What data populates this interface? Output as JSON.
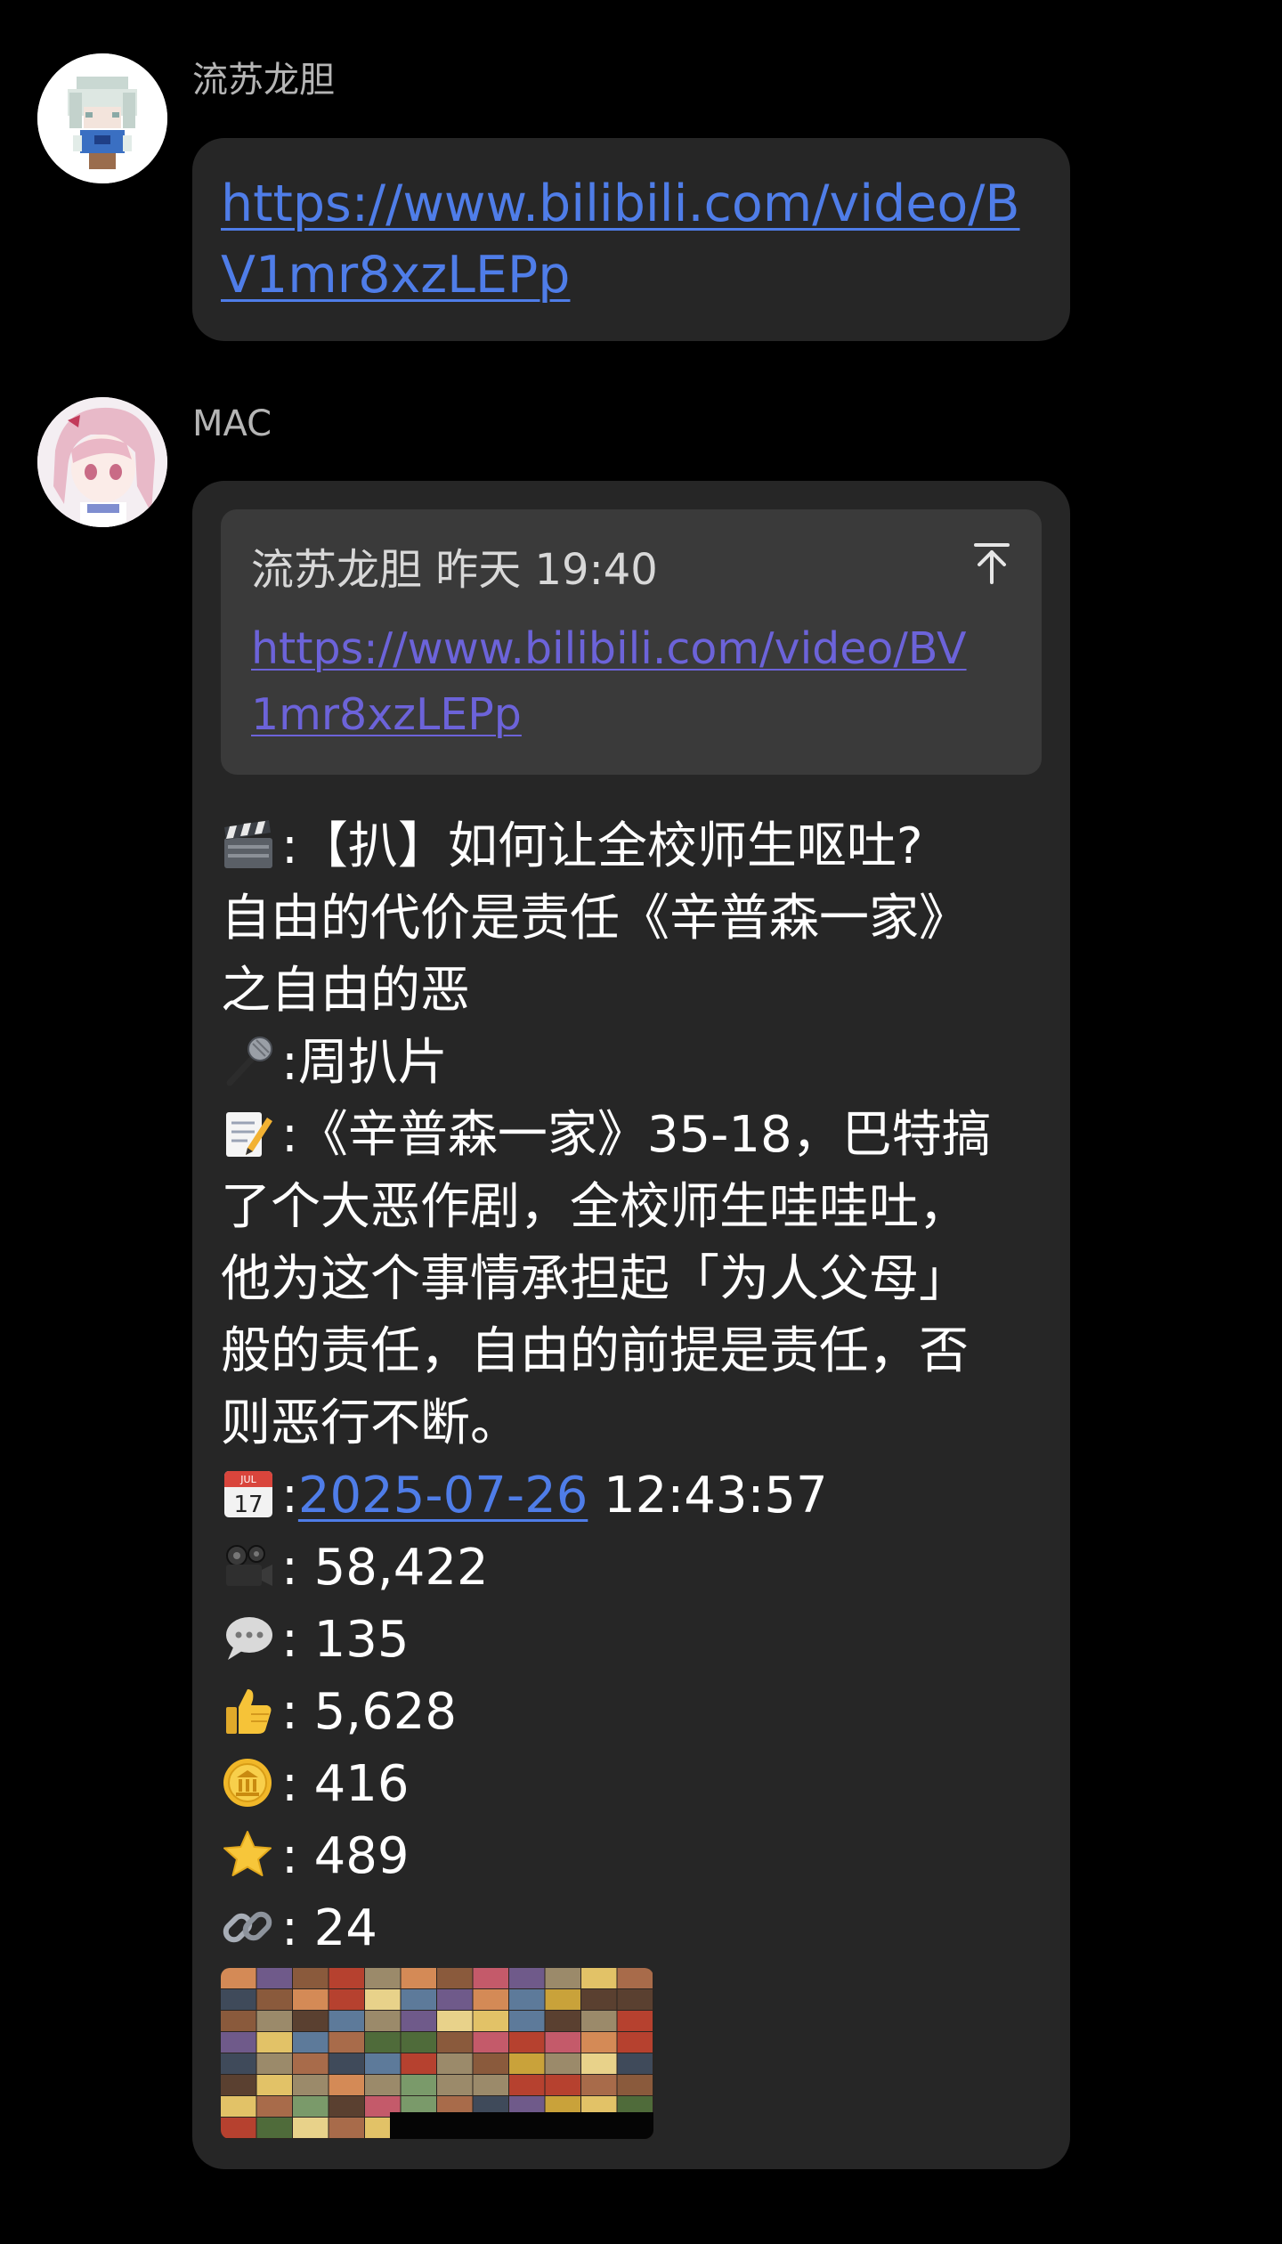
{
  "messages": [
    {
      "sender": "流苏龙胆",
      "link": "https://www.bilibili.com/video/BV1mr8xzLEPp"
    },
    {
      "sender": "MAC",
      "quote": {
        "author": "流苏龙胆",
        "time": "昨天 19:40",
        "header": "流苏龙胆 昨天 19:40",
        "link": "https://www.bilibili.com/video/BV1mr8xzLEPp"
      },
      "lines": {
        "title1": ":【扒】如何让全校师生呕吐?",
        "title2": "自由的代价是责任《辛普森一家》",
        "title3": "之自由的恶",
        "uploader": ":周扒片",
        "desc1": ":《辛普森一家》35-18，巴特搞",
        "desc2": "了个大恶作剧，全校师生哇哇吐，",
        "desc3": "他为这个事情承担起「为人父母」",
        "desc4": "般的责任，自由的前提是责任，否",
        "desc5": "则恶行不断。",
        "date_prefix": ":",
        "date": "2025-07-26",
        "time": " 12:43:57",
        "views": ": 58,422",
        "comments": ": 135",
        "likes": ": 5,628",
        "coins": ": 416",
        "favorites": ": 489",
        "shares": ": 24"
      },
      "icons": [
        "clapper-icon",
        "microphone-icon",
        "memo-icon",
        "calendar-icon",
        "camera-icon",
        "speech-bubble-icon",
        "thumbs-up-icon",
        "coin-icon",
        "star-icon",
        "link-icon"
      ]
    }
  ],
  "colors": {
    "background": "#000000",
    "bubble": "#262626",
    "quote_box": "#3a3a3a",
    "link": "#4f7de8",
    "quote_link": "#6c63d9",
    "sender_name": "#b5b5b5"
  }
}
